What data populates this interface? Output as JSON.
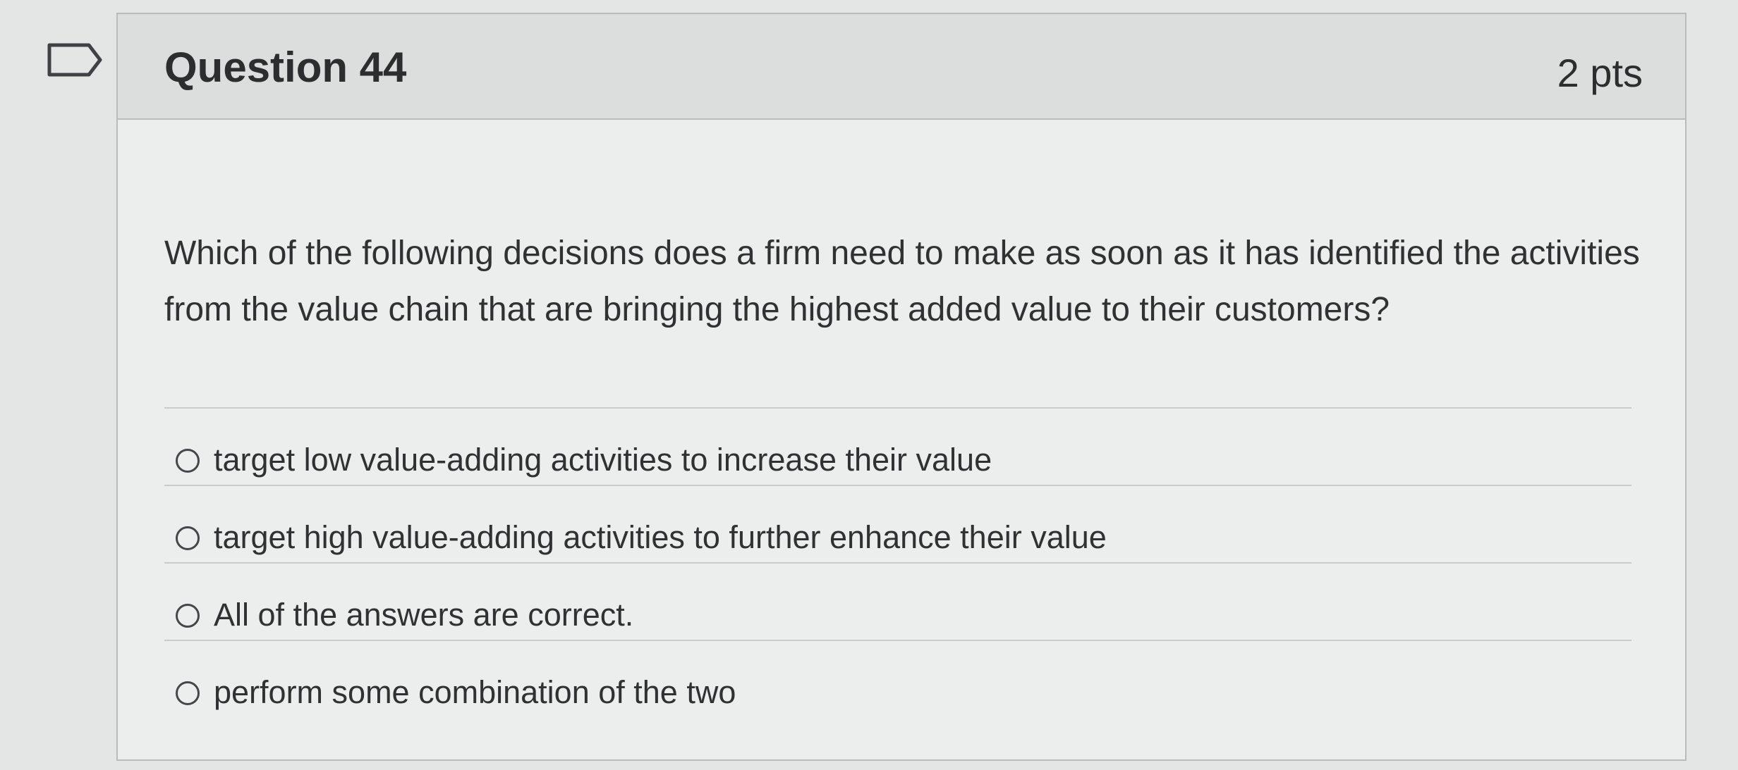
{
  "question": {
    "title": "Question 44",
    "points": "2 pts",
    "text": "Which of the following decisions does a firm need to make as soon as it has identified the activities from the value chain that are bringing the highest added value to their customers?",
    "flag_icon": "flag-icon"
  },
  "answers": [
    {
      "label": "target low value-adding activities to increase their value",
      "selected": false
    },
    {
      "label": "target high value-adding activities to further enhance their value",
      "selected": false
    },
    {
      "label": "All of the answers are correct.",
      "selected": false
    },
    {
      "label": "perform some combination of the two",
      "selected": false
    }
  ],
  "colors": {
    "page_background": "#e4e6e5",
    "card_background": "#eceeed",
    "header_background": "#dcdedd",
    "border": "#b9bbbc",
    "text": "#2f3133"
  }
}
